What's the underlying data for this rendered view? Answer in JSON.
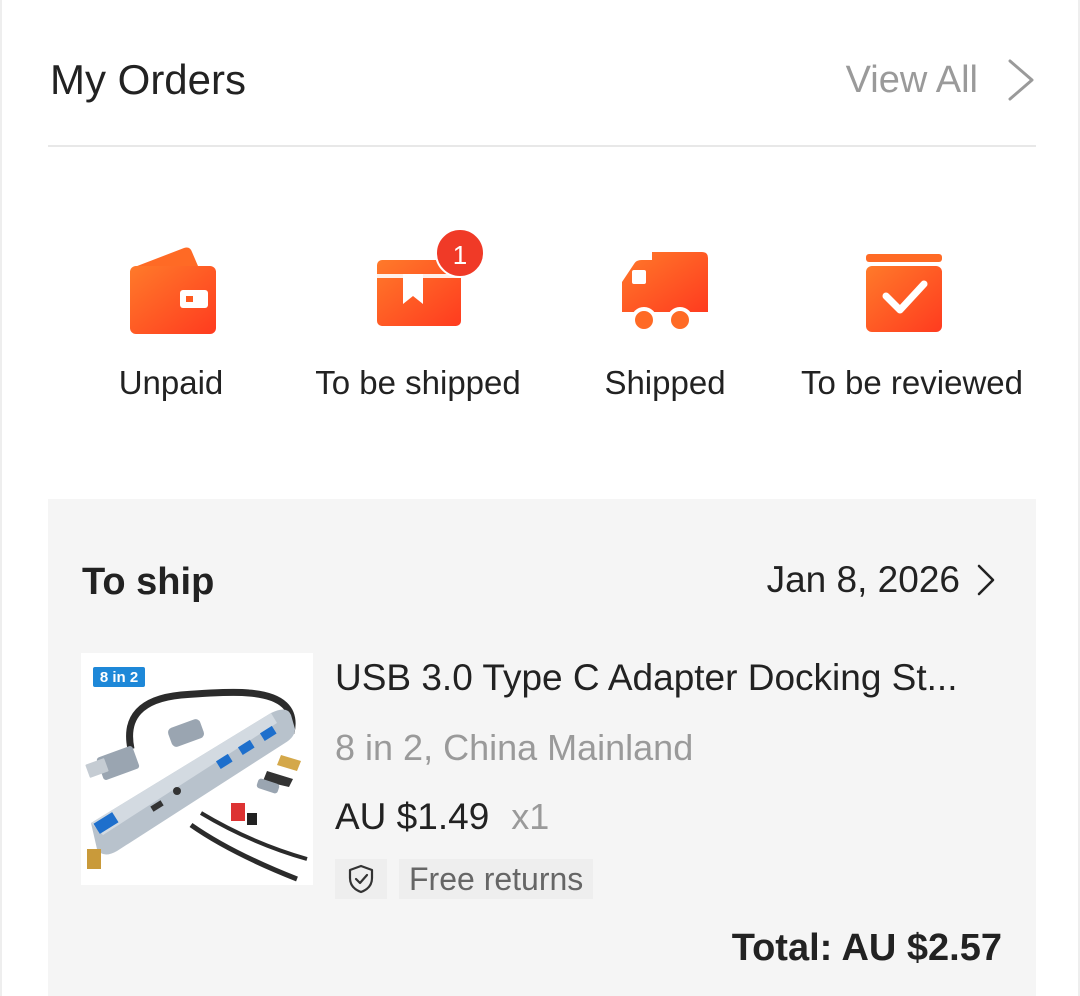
{
  "header": {
    "title": "My Orders",
    "view_all_label": "View All"
  },
  "status_tabs": [
    {
      "label": "Unpaid",
      "icon": "wallet-icon"
    },
    {
      "label": "To be shipped",
      "icon": "package-icon",
      "badge": "1"
    },
    {
      "label": "Shipped",
      "icon": "delivery-truck-icon"
    },
    {
      "label": "To be reviewed",
      "icon": "review-checkbox-icon"
    }
  ],
  "order": {
    "status": "To ship",
    "date": "Jan 8, 2026",
    "product": {
      "name": "USB 3.0 Type C Adapter Docking St...",
      "variant": "8 in 2, China Mainland",
      "price": "AU $1.49",
      "quantity": "x1",
      "image_label": "8 in 2"
    },
    "returns_label": "Free returns",
    "total": "Total: AU $2.57"
  },
  "colors": {
    "accent_orange": "#ff5a1f",
    "badge_red": "#f03a27",
    "muted_text": "#9a9a9a",
    "card_background": "#f5f5f5"
  }
}
